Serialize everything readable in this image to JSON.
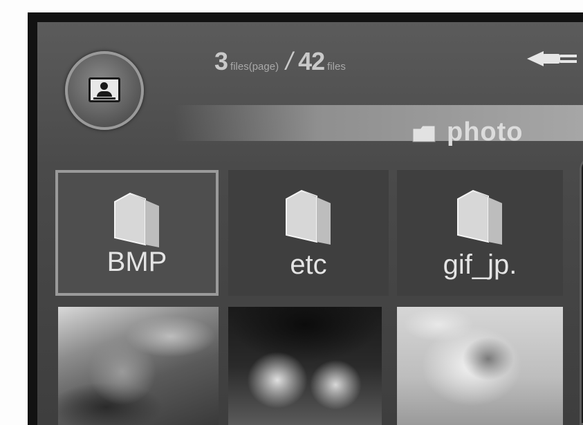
{
  "header": {
    "current_count": "3",
    "current_unit": "files(page)",
    "separator": "/",
    "total_count": "42",
    "total_unit": "files",
    "mode_icon": "photo-mode-icon",
    "power_icon": "plug-icon"
  },
  "path": {
    "folder_icon": "folder-icon",
    "label": "photo"
  },
  "folders": [
    {
      "label": "BMP",
      "selected": true
    },
    {
      "label": "etc",
      "selected": false
    },
    {
      "label": "gif_jp.",
      "selected": false
    }
  ],
  "thumbnails": [
    {
      "name": "photo-thumbnail-1"
    },
    {
      "name": "photo-thumbnail-2"
    },
    {
      "name": "photo-thumbnail-3"
    }
  ],
  "scrollbar": {
    "position": 0.0
  }
}
